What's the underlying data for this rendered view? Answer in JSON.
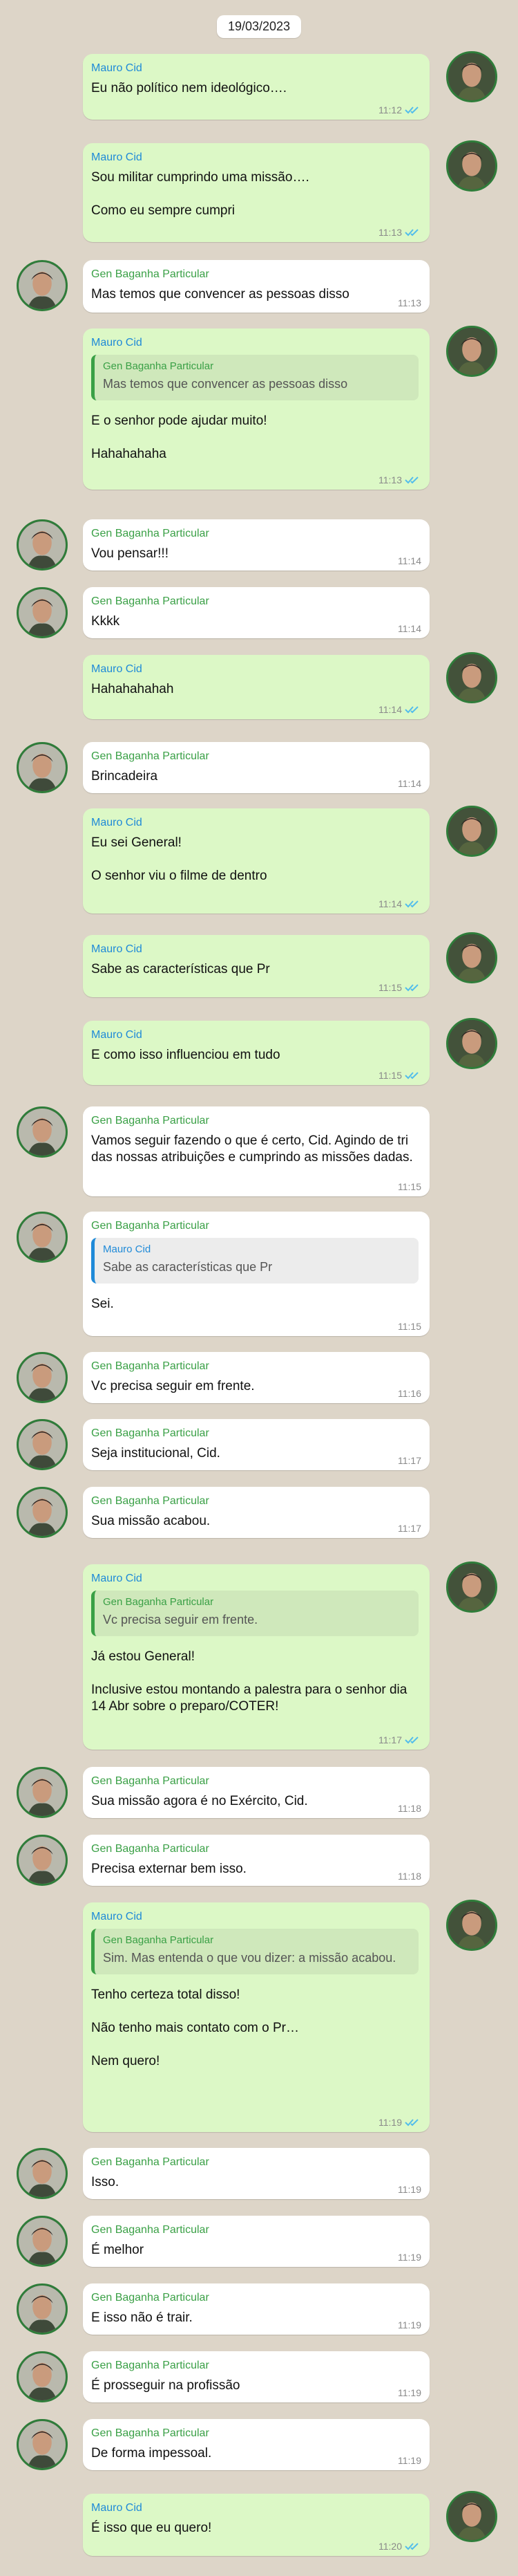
{
  "date": "19/03/2023",
  "icons": {
    "read_receipt": "double-check-icon",
    "accent_read": "#53bdeb"
  },
  "colors": {
    "outgoing_bubble": "#dcf8c6",
    "incoming_bubble": "#ffffff",
    "cid_name": "#1f8ad8",
    "gen_name": "#3aa046"
  },
  "messages": [
    {
      "sender": "Mauro Cid",
      "text": "Eu não político nem ideológico….",
      "time": "11:12"
    },
    {
      "sender": "Mauro Cid",
      "text": "Sou militar cumprindo uma missão….\n\nComo eu sempre cumpri",
      "time": "11:13"
    },
    {
      "sender": "Gen Baganha Particular",
      "text": "Mas temos que convencer as pessoas disso",
      "time": "11:13"
    },
    {
      "sender": "Mauro Cid",
      "quote_sender": "Gen Baganha Particular",
      "quote_text": "Mas temos que convencer as pessoas disso",
      "text": "E o senhor pode ajudar muito!\n\nHahahahaha",
      "time": "11:13"
    },
    {
      "sender": "Gen Baganha Particular",
      "text": "Vou pensar!!!",
      "time": "11:14"
    },
    {
      "sender": "Gen Baganha Particular",
      "text": "Kkkk",
      "time": "11:14"
    },
    {
      "sender": "Mauro Cid",
      "text": "Hahahahahah",
      "time": "11:14"
    },
    {
      "sender": "Gen Baganha Particular",
      "text": "Brincadeira",
      "time": "11:14"
    },
    {
      "sender": "Mauro Cid",
      "text": "Eu sei General!\n\nO senhor viu o filme de dentro",
      "time": "11:14"
    },
    {
      "sender": "Mauro Cid",
      "text": "Sabe as características que Pr",
      "time": "11:15"
    },
    {
      "sender": "Mauro Cid",
      "text": "E como isso influenciou em tudo",
      "time": "11:15"
    },
    {
      "sender": "Gen Baganha Particular",
      "text": "Vamos seguir fazendo o que é certo, Cid. Agindo de tri das nossas atribuições e cumprindo as missões dadas.",
      "time": "11:15"
    },
    {
      "sender": "Gen Baganha Particular",
      "quote_sender": "Mauro Cid",
      "quote_text": "Sabe as características que Pr",
      "text": "Sei.",
      "time": "11:15"
    },
    {
      "sender": "Gen Baganha Particular",
      "text": "Vc precisa seguir em frente.",
      "time": "11:16"
    },
    {
      "sender": "Gen Baganha Particular",
      "text": "Seja institucional, Cid.",
      "time": "11:17"
    },
    {
      "sender": "Gen Baganha Particular",
      "text": "Sua missão acabou.",
      "time": "11:17"
    },
    {
      "sender": "Mauro Cid",
      "quote_sender": "Gen Baganha Particular",
      "quote_text": "Vc precisa seguir em frente.",
      "text": "Já estou General!\n\nInclusive estou montando a palestra para o senhor dia 14 Abr sobre o preparo/COTER!",
      "time": "11:17"
    },
    {
      "sender": "Gen Baganha Particular",
      "text": "Sua missão agora é no Exército, Cid.",
      "time": "11:18"
    },
    {
      "sender": "Gen Baganha Particular",
      "text": "Precisa externar bem isso.",
      "time": "11:18"
    },
    {
      "sender": "Mauro Cid",
      "quote_sender": "Gen Baganha Particular",
      "quote_text": "Sim. Mas entenda o que vou dizer: a missão acabou.",
      "text": "Tenho certeza total disso!\n\nNão tenho mais contato com o Pr…\n\nNem quero!",
      "time": "11:19"
    },
    {
      "sender": "Gen Baganha Particular",
      "text": "Isso.",
      "time": "11:19"
    },
    {
      "sender": "Gen Baganha Particular",
      "text": "É melhor",
      "time": "11:19"
    },
    {
      "sender": "Gen Baganha Particular",
      "text": "E isso não é trair.",
      "time": "11:19"
    },
    {
      "sender": "Gen Baganha Particular",
      "text": "É prosseguir na profissão",
      "time": "11:19"
    },
    {
      "sender": "Gen Baganha Particular",
      "text": "De forma impessoal.",
      "time": "11:19"
    },
    {
      "sender": "Mauro Cid",
      "text": "É isso que eu quero!",
      "time": "11:20"
    }
  ]
}
